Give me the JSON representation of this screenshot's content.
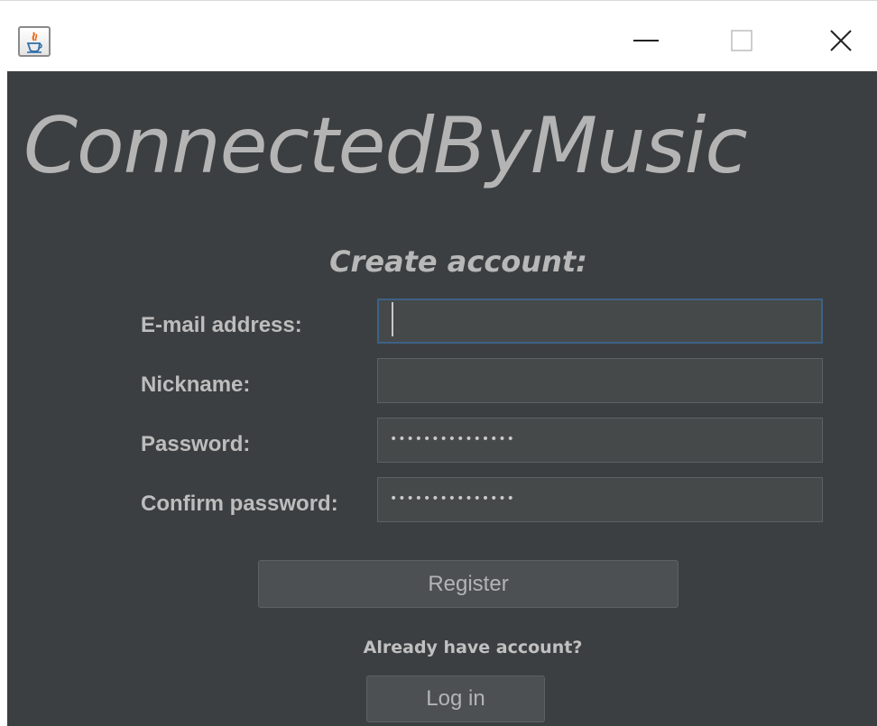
{
  "titlebar": {
    "app_icon": "java-icon",
    "minimize_icon": "minimize-icon",
    "maximize_icon": "maximize-icon",
    "close_icon": "close-icon"
  },
  "app": {
    "title": "ConnectedByMusic",
    "subtitle": "Create account:"
  },
  "form": {
    "email": {
      "label": "E-mail address:",
      "value": ""
    },
    "nickname": {
      "label": "Nickname:",
      "value": ""
    },
    "password": {
      "label": "Password:",
      "masked": "•••••••••••••••"
    },
    "confirm": {
      "label": "Confirm password:",
      "masked": "•••••••••••••••"
    }
  },
  "actions": {
    "register_label": "Register",
    "hint": "Already have account?",
    "login_label": "Log in"
  },
  "colors": {
    "background": "#3c3f41",
    "input_bg": "#45494a",
    "focus_border": "#3d6185",
    "text": "#bbbbbb"
  }
}
